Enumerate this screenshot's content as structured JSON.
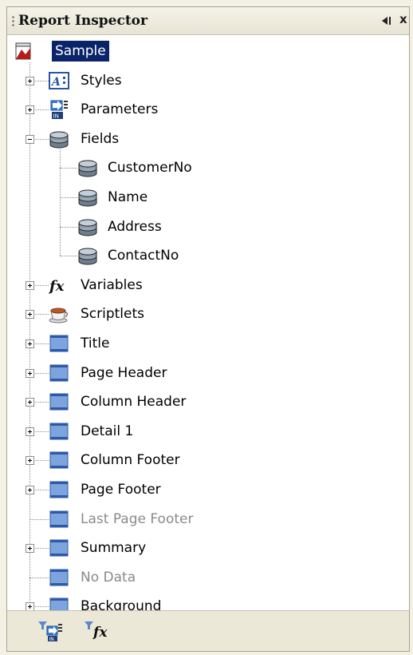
{
  "panel": {
    "title": "Report Inspector",
    "pin_icon": "pin-icon",
    "close_label": "x"
  },
  "tree": {
    "root": {
      "label": "Sample",
      "icon": "report-icon",
      "selected": true
    },
    "items": [
      {
        "label": "Styles",
        "icon": "styles-icon",
        "expander": "plus"
      },
      {
        "label": "Parameters",
        "icon": "parameters-icon",
        "expander": "plus"
      },
      {
        "label": "Fields",
        "icon": "database-icon",
        "expander": "minus",
        "children": [
          {
            "label": "CustomerNo",
            "icon": "database-icon"
          },
          {
            "label": "Name",
            "icon": "database-icon"
          },
          {
            "label": "Address",
            "icon": "database-icon"
          },
          {
            "label": "ContactNo",
            "icon": "database-icon"
          }
        ]
      },
      {
        "label": "Variables",
        "icon": "function-icon",
        "expander": "plus"
      },
      {
        "label": "Scriptlets",
        "icon": "coffee-cup-icon",
        "expander": "plus"
      },
      {
        "label": "Title",
        "icon": "band-icon",
        "expander": "plus"
      },
      {
        "label": "Page Header",
        "icon": "band-icon",
        "expander": "plus"
      },
      {
        "label": "Column Header",
        "icon": "band-icon",
        "expander": "plus"
      },
      {
        "label": "Detail 1",
        "icon": "band-icon",
        "expander": "plus"
      },
      {
        "label": "Column Footer",
        "icon": "band-icon",
        "expander": "plus"
      },
      {
        "label": "Page Footer",
        "icon": "band-icon",
        "expander": "plus"
      },
      {
        "label": "Last Page Footer",
        "icon": "band-icon",
        "expander": "none",
        "disabled": true
      },
      {
        "label": "Summary",
        "icon": "band-icon",
        "expander": "plus"
      },
      {
        "label": "No Data",
        "icon": "band-icon",
        "expander": "none",
        "disabled": true
      },
      {
        "label": "Background",
        "icon": "band-icon",
        "expander": "plus"
      }
    ]
  },
  "toolbar": {
    "buttons": [
      {
        "icon": "add-parameter-icon"
      },
      {
        "icon": "add-variable-icon"
      }
    ]
  },
  "colors": {
    "selection": "#0a246a",
    "band": "#4a76c4",
    "disabled_text": "#8a8a8a"
  }
}
